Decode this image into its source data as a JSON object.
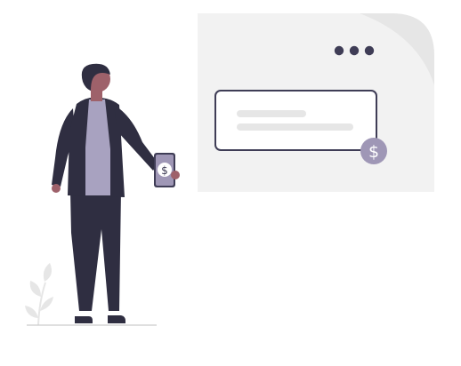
{
  "illustration": {
    "currency_symbol": "$",
    "menu_dots": 3,
    "text_lines": 2,
    "icons": {
      "person": "person-holding-phone-icon",
      "phone": "phone-icon",
      "dollar": "dollar-sign-icon",
      "menu": "more-dots-icon",
      "plant": "plant-icon"
    }
  },
  "colors": {
    "background": "#ffffff",
    "window_fill": "#f2f2f2",
    "window_corner": "#e6e6e6",
    "card_border": "#3f3d56",
    "placeholder_line": "#e6e6e6",
    "dot": "#3f3d56",
    "badge": "#9f97b6",
    "dollar_text": "#ffffff",
    "jacket": "#2f2e41",
    "shirt": "#a8a2c0",
    "pants": "#2f2e41",
    "skin": "#9e616a",
    "hair": "#2f2e41",
    "plant": "#e6e6e6",
    "ground": "#cccccc"
  }
}
